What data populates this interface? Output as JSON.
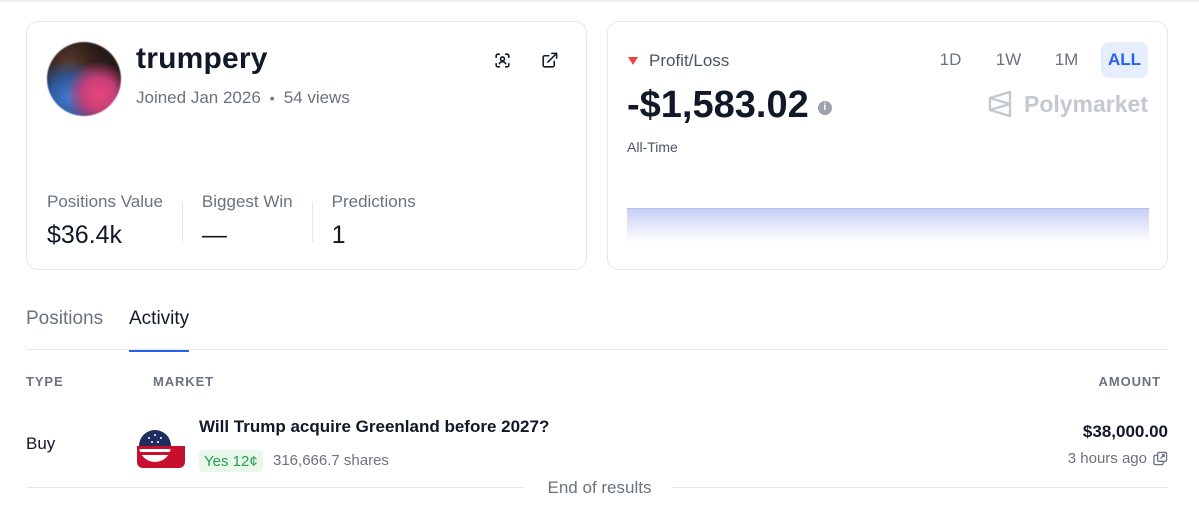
{
  "profile": {
    "username": "trumpery",
    "joined": "Joined Jan 2026",
    "views": "54 views",
    "icons": [
      "scan-icon",
      "external-link-icon"
    ],
    "stats": [
      {
        "label": "Positions Value",
        "value": "$36.4k"
      },
      {
        "label": "Biggest Win",
        "value": "—"
      },
      {
        "label": "Predictions",
        "value": "1"
      }
    ]
  },
  "pnl": {
    "label": "Profit/Loss",
    "value": "-$1,583.02",
    "info": "i",
    "period": "All-Time",
    "ranges": [
      "1D",
      "1W",
      "1M",
      "ALL"
    ],
    "active_range": "ALL",
    "brand": "Polymarket",
    "accent": "#2563eb",
    "loss_color": "#ef4444"
  },
  "tabs": [
    "Positions",
    "Activity"
  ],
  "active_tab": "Activity",
  "table": {
    "headers": {
      "type": "TYPE",
      "market": "MARKET",
      "amount": "AMOUNT"
    },
    "rows": [
      {
        "type": "Buy",
        "market": "Will Trump acquire Greenland before 2027?",
        "outcome": "Yes 12¢",
        "shares": "316,666.7 shares",
        "amount": "$38,000.00",
        "time": "3 hours ago"
      }
    ]
  },
  "footer": {
    "end_text": "End of results"
  }
}
